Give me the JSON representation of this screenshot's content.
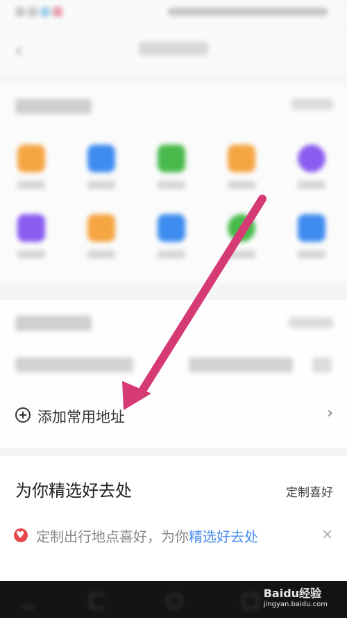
{
  "add_address": {
    "label": "添加常用地址"
  },
  "recommend": {
    "title": "为你精选好去处",
    "customize_label": "定制喜好",
    "tip_prefix": "定制出行地点喜好，为你",
    "tip_link": "精选好去处",
    "close_symbol": "×"
  },
  "chevron": "›",
  "watermark": {
    "brand": "Baidu经验",
    "url": "jingyan.baidu.com"
  },
  "colors": {
    "arrow": "#d63a74",
    "link": "#4a8cf0",
    "tools": [
      "#f6a543",
      "#3e8cf0",
      "#48b94b",
      "#f6a543",
      "#8a5cf0",
      "#8a5cf0",
      "#f6a543",
      "#3e8cf0",
      "#48b94b",
      "#3e8cf0"
    ]
  }
}
